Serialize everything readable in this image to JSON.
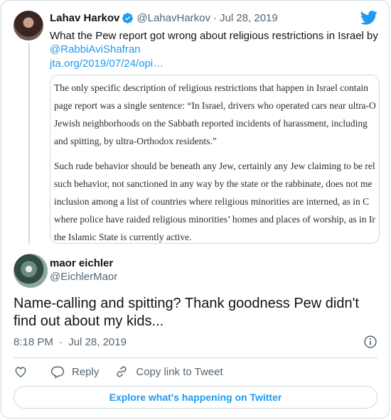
{
  "quoted_tweet": {
    "author_name": "Lahav Harkov",
    "author_handle": "@LahavHarkov",
    "separator": "·",
    "date": "Jul 28, 2019",
    "text": "What the Pew report got wrong about religious restrictions in Israel by",
    "mention": "@RabbiAviShafran",
    "url": "jta.org/2019/07/24/opi…",
    "media": {
      "paragraph_1": [
        "The only specific description of religious restrictions that happen in Israel contain",
        "page report was a single sentence: “In Israel, drivers who operated cars near ultra-O",
        "Jewish neighborhoods on the Sabbath reported incidents of harassment, including",
        "and spitting, by ultra-Orthodox residents.”"
      ],
      "paragraph_2": [
        "Such rude behavior should be beneath any Jew, certainly any Jew claiming to be rel",
        "such behavior, not sanctioned in any way by the state or the rabbinate, does not me",
        "inclusion among a list of countries where religious minorities are interned, as in C",
        "where police have raided religious minorities’ homes and places of worship, as in Ir",
        "the Islamic State is currently active."
      ]
    }
  },
  "reply_tweet": {
    "author_name": "maor eichler",
    "author_handle": "@EichlerMaor",
    "text": "Name-calling and spitting? Thank goodness Pew didn't find out about my kids...",
    "time": "8:18 PM",
    "separator": "·",
    "date": "Jul 28, 2019"
  },
  "actions": {
    "reply_label": "Reply",
    "copy_link_label": "Copy link to Tweet"
  },
  "explore_label": "Explore what's happening on Twitter",
  "colors": {
    "accent": "#1d9bf0",
    "text": "#0f1419",
    "secondary_text": "#536471",
    "border": "#cfd9de"
  },
  "icons": [
    "twitter-logo-icon",
    "verified-badge-icon",
    "info-icon",
    "heart-icon",
    "reply-icon",
    "link-icon"
  ]
}
